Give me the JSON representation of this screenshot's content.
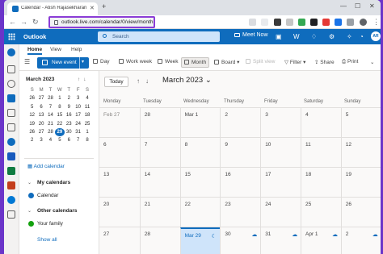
{
  "browser": {
    "tab_title": "Calendar - Atish Rajasekharan - Outlook",
    "url": "outlook.live.com/calendar/0/view/month"
  },
  "header": {
    "app_name": "Outlook",
    "search_placeholder": "Search",
    "meet_now": "Meet Now",
    "avatar_initials": "AR"
  },
  "ribbon": {
    "tabs": [
      "Home",
      "View",
      "Help"
    ],
    "new_event": "New event",
    "views": [
      "Day",
      "Work week",
      "Week",
      "Month",
      "Board",
      "Split view"
    ],
    "filter": "Filter",
    "share": "Share",
    "print": "Print"
  },
  "mini_calendar": {
    "title": "March 2023",
    "weekdays": [
      "S",
      "M",
      "T",
      "W",
      "T",
      "F",
      "S"
    ],
    "weeks": [
      [
        "26",
        "27",
        "28",
        "1",
        "2",
        "3",
        "4"
      ],
      [
        "5",
        "6",
        "7",
        "8",
        "9",
        "10",
        "11"
      ],
      [
        "12",
        "13",
        "14",
        "15",
        "16",
        "17",
        "18"
      ],
      [
        "19",
        "20",
        "21",
        "22",
        "23",
        "24",
        "25"
      ],
      [
        "26",
        "27",
        "28",
        "29",
        "30",
        "31",
        "1"
      ],
      [
        "2",
        "3",
        "4",
        "5",
        "6",
        "7",
        "8"
      ]
    ],
    "today": "29"
  },
  "sidebar": {
    "add_calendar": "Add calendar",
    "my_calendars": "My calendars",
    "calendar": "Calendar",
    "other_calendars": "Other calendars",
    "your_family": "Your family",
    "show_all": "Show all"
  },
  "main": {
    "today_button": "Today",
    "month_title": "March 2023",
    "days": [
      "Sunday",
      "Monday",
      "Tuesday",
      "Wednesday",
      "Thursday",
      "Friday",
      "Saturday",
      "Sunday"
    ],
    "weeks": [
      [
        "Feb 27",
        "28",
        "Mar 1",
        "2",
        "3",
        "4",
        "5"
      ],
      [
        "6",
        "7",
        "8",
        "9",
        "10",
        "11",
        "12"
      ],
      [
        "13",
        "14",
        "15",
        "16",
        "17",
        "18",
        "19"
      ],
      [
        "20",
        "21",
        "22",
        "23",
        "24",
        "25",
        "26"
      ],
      [
        "27",
        "28",
        "Mar 29",
        "30",
        "31",
        "Apr 1",
        "2"
      ]
    ]
  },
  "colors": {
    "accent": "#0f6cbd",
    "frame": "#6b35c9",
    "url_highlight": "#8b3dd6"
  }
}
